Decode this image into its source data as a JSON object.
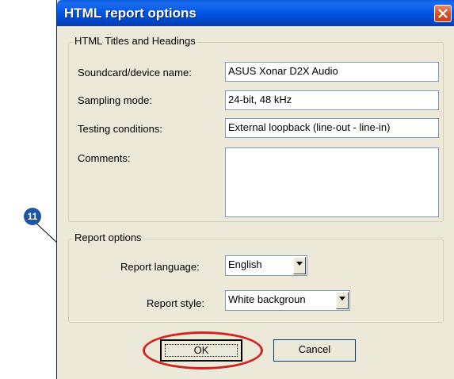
{
  "window": {
    "title": "HTML report options"
  },
  "titles_group": {
    "legend": "HTML Titles and Headings",
    "fields": [
      {
        "label": "Soundcard/device name:",
        "value": "ASUS Xonar D2X Audio"
      },
      {
        "label": "Sampling mode:",
        "value": "24-bit, 48 kHz"
      },
      {
        "label": "Testing conditions:",
        "value": "External loopback (line-out - line-in)"
      },
      {
        "label": "Comments:",
        "value": ""
      }
    ]
  },
  "report_group": {
    "legend": "Report options",
    "language": {
      "label": "Report language:",
      "value": "English"
    },
    "style": {
      "label": "Report style:",
      "value": "White backgroun"
    }
  },
  "buttons": {
    "ok": "OK",
    "cancel": "Cancel"
  },
  "callout": {
    "number": "11",
    "color": "#d22323",
    "badge_color": "#1d55a4"
  },
  "colors": {
    "titlebar": "#0058e6",
    "dialog_bg": "#ece9d8"
  }
}
